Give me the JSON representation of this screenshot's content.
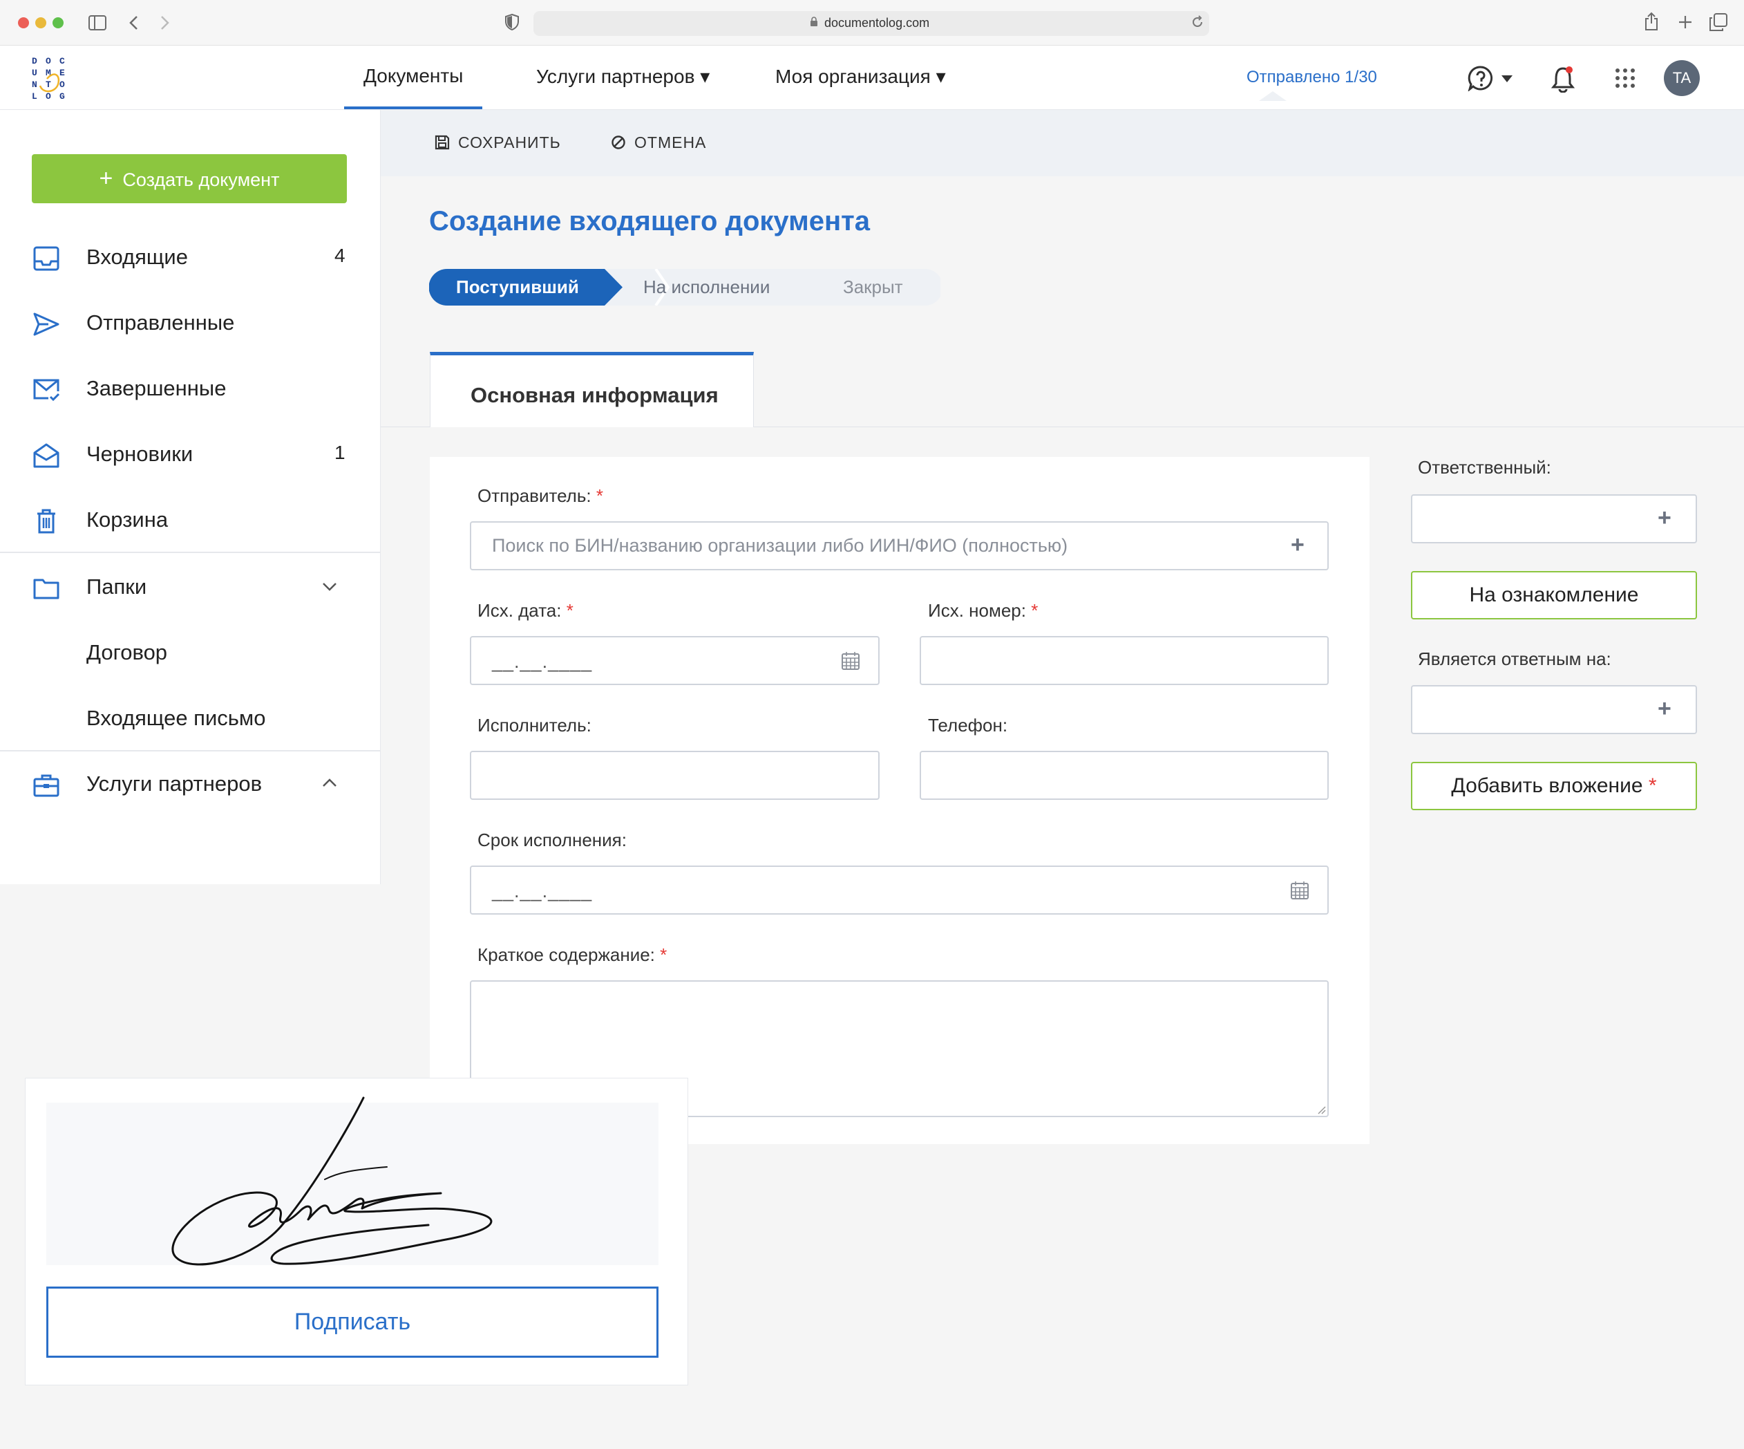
{
  "browser": {
    "url": "documentolog.com"
  },
  "header": {
    "logo_letters": "D O C U M E N T O L O G",
    "nav": [
      {
        "label": "Документы"
      },
      {
        "label": "Услуги партнеров ▾"
      },
      {
        "label": "Моя организация ▾"
      }
    ],
    "sent_counter": "Отправлено 1/30",
    "avatar_initials": "TA"
  },
  "sidebar": {
    "create_button": "Создать документ",
    "items": [
      {
        "label": "Входящие",
        "count": "4"
      },
      {
        "label": "Отправленные",
        "count": ""
      },
      {
        "label": "Завершенные",
        "count": ""
      },
      {
        "label": "Черновики",
        "count": "1"
      },
      {
        "label": "Корзина",
        "count": ""
      }
    ],
    "folders": {
      "label": "Папки",
      "children": [
        {
          "label": "Договор"
        },
        {
          "label": "Входящее письмо"
        }
      ]
    },
    "partner_services": "Услуги партнеров"
  },
  "toolbar": {
    "save_label": "СОХРАНИТЬ",
    "cancel_label": "ОТМЕНА"
  },
  "page": {
    "title": "Создание входящего документа",
    "stages": [
      {
        "label": "Поступивший",
        "active": true
      },
      {
        "label": "На исполнении",
        "active": false
      },
      {
        "label": "Закрыт",
        "active": false
      }
    ],
    "tab": "Основная информация"
  },
  "form": {
    "sender_label": "Отправитель:",
    "sender_placeholder": "Поиск по БИН/названию организации либо ИИН/ФИО (полностью)",
    "out_date_label": "Исх. дата:",
    "out_date_mask": "__.__.____",
    "out_number_label": "Исх. номер:",
    "executor_label": "Исполнитель:",
    "phone_label": "Телефон:",
    "deadline_label": "Срок исполнения:",
    "deadline_mask": "__.__.____",
    "summary_label": "Краткое содержание:",
    "required_mark": "*"
  },
  "right_panel": {
    "responsible_label": "Ответственный:",
    "review_button": "На ознакомление",
    "reply_to_label": "Является ответным на:",
    "attach_button": "Добавить вложение"
  },
  "signature": {
    "sign_button": "Подписать"
  },
  "colors": {
    "accent_blue": "#2a6fc9",
    "create_green": "#8cc63f",
    "required_red": "#e53935"
  }
}
